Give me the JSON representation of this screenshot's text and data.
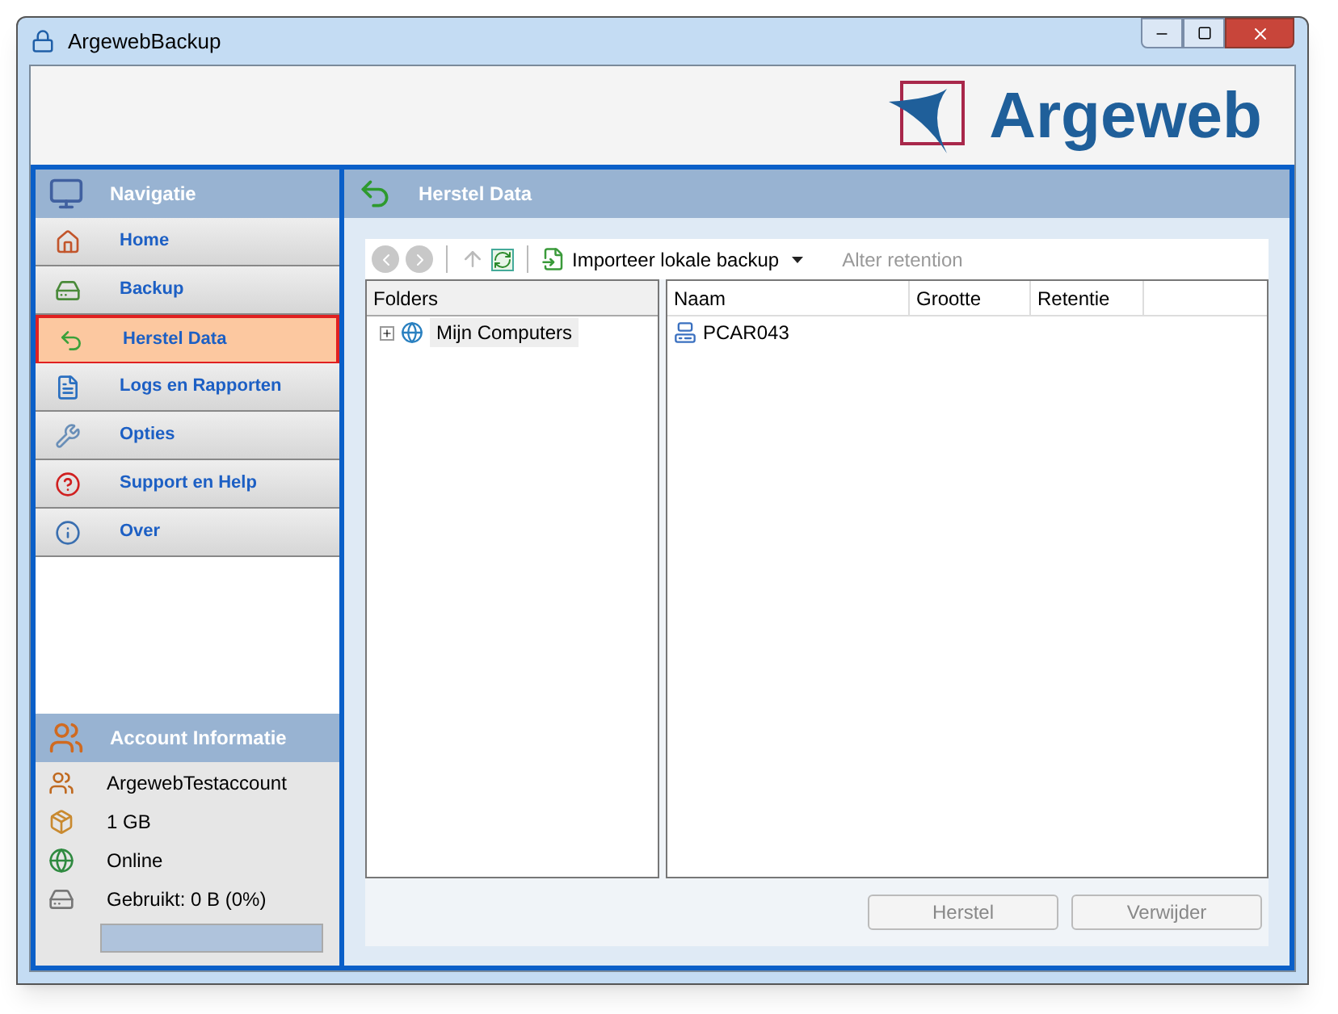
{
  "window": {
    "title": "ArgewebBackup"
  },
  "logo": {
    "text": "Argeweb"
  },
  "navigation": {
    "title": "Navigatie",
    "items": [
      {
        "label": "Home",
        "selected": false
      },
      {
        "label": "Backup",
        "selected": false
      },
      {
        "label": "Herstel Data",
        "selected": true
      },
      {
        "label": "Logs en Rapporten",
        "selected": false
      },
      {
        "label": "Opties",
        "selected": false
      },
      {
        "label": "Support en Help",
        "selected": false
      },
      {
        "label": "Over",
        "selected": false
      }
    ]
  },
  "account": {
    "title": "Account Informatie",
    "items": [
      {
        "text": "ArgewebTestaccount"
      },
      {
        "text": "1 GB"
      },
      {
        "text": "Online"
      },
      {
        "text": "Gebruikt: 0 B (0%)"
      }
    ],
    "usage": {
      "level": 0
    }
  },
  "panel": {
    "title": "Herstel Data",
    "toolbar": {
      "import": "Importeer lokale backup",
      "alter": {
        "label": "Alter retention",
        "disabled": true
      }
    },
    "folders": {
      "header": "Folders",
      "tree": [
        {
          "label": "Mijn Computers",
          "expanded": false
        }
      ]
    },
    "table": {
      "columns": [
        "Naam",
        "Grootte",
        "Retentie"
      ],
      "rows": [
        {
          "name": "PCAR043"
        }
      ]
    },
    "buttons": [
      {
        "label": "Herstel",
        "disabled": true
      },
      {
        "label": "Verwijder",
        "disabled": true
      }
    ]
  }
}
